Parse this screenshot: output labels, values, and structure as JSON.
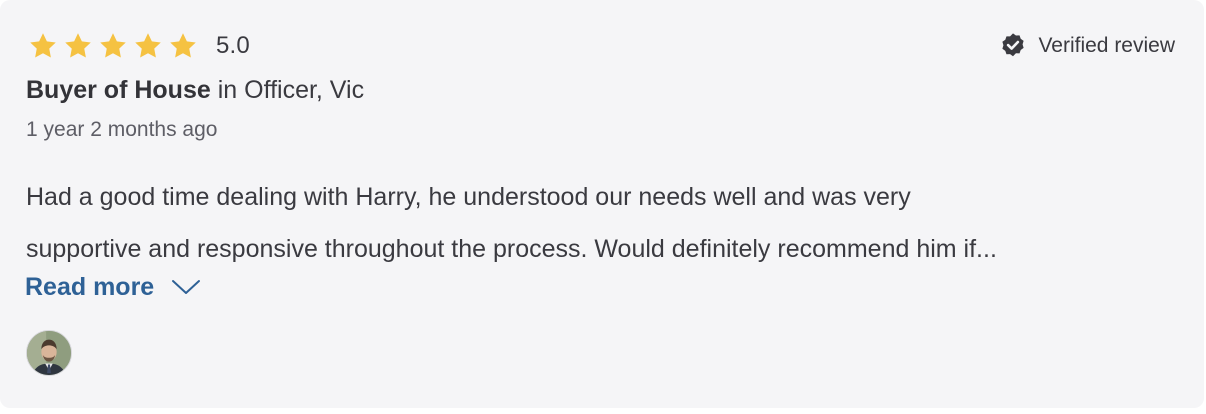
{
  "review": {
    "rating": 5,
    "rating_value": "5.0",
    "verified_label": "Verified review",
    "author_name": "Buyer of House",
    "location_text": "in Officer, Vic",
    "time_ago": "1 year 2 months ago",
    "text_lines": [
      "Had a good time dealing with Harry, he understood our needs well and was very",
      "supportive and responsive throughout the process. Would definitely recommend him if..."
    ],
    "read_more_label": "Read more"
  },
  "colors": {
    "star": "#f5c242",
    "link": "#2e6196",
    "text": "#3a3a40",
    "card_background": "#f5f5f7"
  },
  "icons": {
    "star": "star-icon",
    "verified": "verified-badge-icon",
    "expand": "chevron-down-icon"
  }
}
